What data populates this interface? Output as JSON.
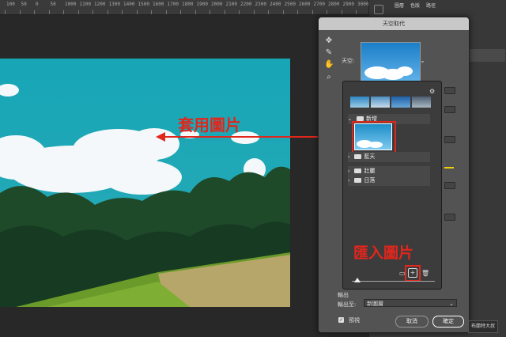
{
  "ruler": {
    "ticks": [
      "100",
      "50",
      "0",
      "50",
      "1000",
      "1100",
      "1200",
      "1300",
      "1400",
      "1500",
      "1600",
      "1700",
      "1800",
      "1900",
      "2000",
      "2100",
      "2200",
      "2300",
      "2400",
      "2500",
      "2600",
      "2700",
      "2800",
      "2900",
      "3000"
    ]
  },
  "panels": {
    "tabs": [
      "圖層",
      "色版",
      "路徑"
    ]
  },
  "dialog": {
    "title": "天空取代",
    "sky_label": "天空:",
    "sky_preset_tooltip_icon": "gear-icon",
    "folders": [
      {
        "name": "新增",
        "expanded": true
      },
      {
        "name": "藍天",
        "expanded": false
      },
      {
        "name": "壯麗",
        "expanded": false
      },
      {
        "name": "日落",
        "expanded": false
      }
    ],
    "output_section": "輸出",
    "output_to_label": "輸出至:",
    "output_to_value": "新圖層",
    "preview_label": "預視",
    "cancel_label": "取消",
    "ok_label": "確定"
  },
  "annotations": {
    "apply_image": "套用圖片",
    "import_image": "匯入圖片"
  },
  "watermark": "布蘭特大叔",
  "colors": {
    "annotation_red": "#e1261c",
    "sky_teal": "#1ea3b0",
    "dialog_bg": "#535353"
  }
}
